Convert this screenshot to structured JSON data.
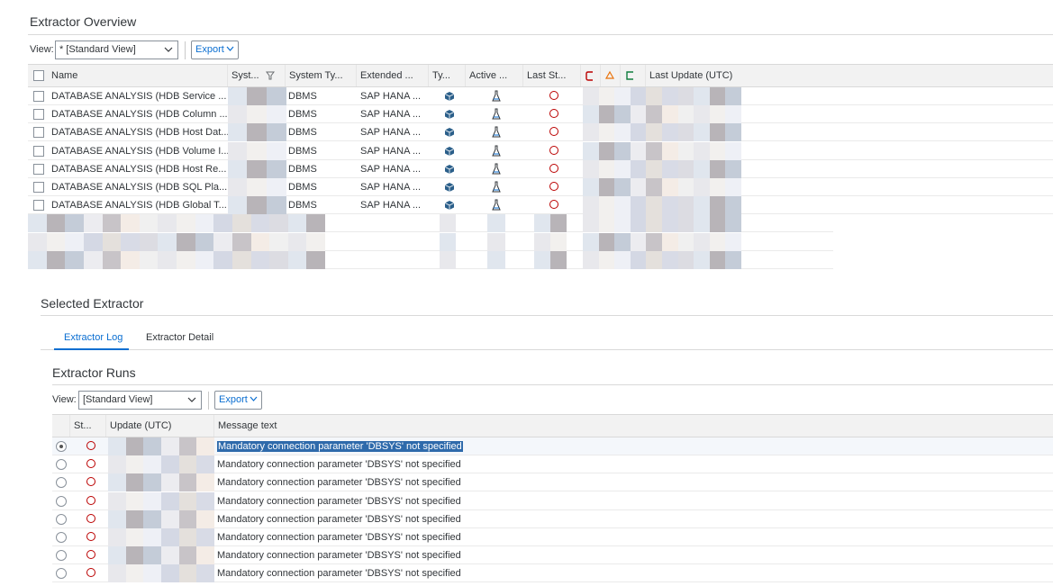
{
  "overview": {
    "title": "Extractor Overview",
    "view_label": "View:",
    "view_value": "* [Standard View]",
    "export_label": "Export",
    "columns": {
      "name": "Name",
      "system": "Syst...",
      "system_type": "System Ty...",
      "extended": "Extended ...",
      "type": "Ty...",
      "active": "Active ...",
      "last_status": "Last St...",
      "last_update": "Last Update (UTC)"
    },
    "rows": [
      {
        "name": "DATABASE ANALYSIS (HDB Service ...",
        "system_type": "DBMS",
        "extended": "SAP HANA ..."
      },
      {
        "name": "DATABASE ANALYSIS (HDB Column ...",
        "system_type": "DBMS",
        "extended": "SAP HANA ..."
      },
      {
        "name": "DATABASE ANALYSIS (HDB Host Dat...",
        "system_type": "DBMS",
        "extended": "SAP HANA ..."
      },
      {
        "name": "DATABASE ANALYSIS (HDB Volume I...",
        "system_type": "DBMS",
        "extended": "SAP HANA ..."
      },
      {
        "name": "DATABASE ANALYSIS (HDB Host Re...",
        "system_type": "DBMS",
        "extended": "SAP HANA ..."
      },
      {
        "name": "DATABASE ANALYSIS (HDB SQL Pla...",
        "system_type": "DBMS",
        "extended": "SAP HANA ..."
      },
      {
        "name": "DATABASE ANALYSIS (HDB Global T...",
        "system_type": "DBMS",
        "extended": "SAP HANA ..."
      }
    ],
    "status_colors": {
      "error": "#bb0000",
      "warning": "#e9730c",
      "success": "#107e3e"
    }
  },
  "selected": {
    "title": "Selected Extractor",
    "tabs": [
      {
        "label": "Extractor Log"
      },
      {
        "label": "Extractor Detail"
      }
    ]
  },
  "runs": {
    "title": "Extractor Runs",
    "view_label": "View:",
    "view_value": "[Standard View]",
    "export_label": "Export",
    "columns": {
      "status": "St...",
      "update": "Update (UTC)",
      "message": "Message text"
    },
    "rows": [
      {
        "message": "Mandatory connection parameter 'DBSYS' not specified"
      },
      {
        "message": "Mandatory connection parameter 'DBSYS' not specified"
      },
      {
        "message": "Mandatory connection parameter 'DBSYS' not specified"
      },
      {
        "message": "Mandatory connection parameter 'DBSYS' not specified"
      },
      {
        "message": "Mandatory connection parameter 'DBSYS' not specified"
      },
      {
        "message": "Mandatory connection parameter 'DBSYS' not specified"
      },
      {
        "message": "Mandatory connection parameter 'DBSYS' not specified"
      },
      {
        "message": "Mandatory connection parameter 'DBSYS' not specified"
      }
    ]
  },
  "icons": {
    "filter": "filter-icon",
    "chevron": "chevron-down-icon",
    "type": "cube-icon",
    "active": "flask-icon",
    "status": "error-circle-icon",
    "col_error": "error-bracket-icon",
    "col_warning": "warning-triangle-icon",
    "col_success": "success-bracket-icon"
  }
}
